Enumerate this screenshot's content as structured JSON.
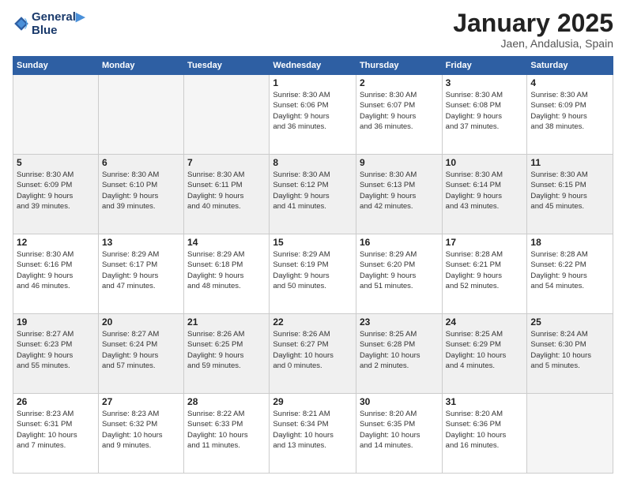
{
  "header": {
    "logo_line1": "General",
    "logo_line2": "Blue",
    "title": "January 2025",
    "subtitle": "Jaen, Andalusia, Spain"
  },
  "days_of_week": [
    "Sunday",
    "Monday",
    "Tuesday",
    "Wednesday",
    "Thursday",
    "Friday",
    "Saturday"
  ],
  "weeks": [
    [
      {
        "day": "",
        "info": ""
      },
      {
        "day": "",
        "info": ""
      },
      {
        "day": "",
        "info": ""
      },
      {
        "day": "1",
        "info": "Sunrise: 8:30 AM\nSunset: 6:06 PM\nDaylight: 9 hours\nand 36 minutes."
      },
      {
        "day": "2",
        "info": "Sunrise: 8:30 AM\nSunset: 6:07 PM\nDaylight: 9 hours\nand 36 minutes."
      },
      {
        "day": "3",
        "info": "Sunrise: 8:30 AM\nSunset: 6:08 PM\nDaylight: 9 hours\nand 37 minutes."
      },
      {
        "day": "4",
        "info": "Sunrise: 8:30 AM\nSunset: 6:09 PM\nDaylight: 9 hours\nand 38 minutes."
      }
    ],
    [
      {
        "day": "5",
        "info": "Sunrise: 8:30 AM\nSunset: 6:09 PM\nDaylight: 9 hours\nand 39 minutes."
      },
      {
        "day": "6",
        "info": "Sunrise: 8:30 AM\nSunset: 6:10 PM\nDaylight: 9 hours\nand 39 minutes."
      },
      {
        "day": "7",
        "info": "Sunrise: 8:30 AM\nSunset: 6:11 PM\nDaylight: 9 hours\nand 40 minutes."
      },
      {
        "day": "8",
        "info": "Sunrise: 8:30 AM\nSunset: 6:12 PM\nDaylight: 9 hours\nand 41 minutes."
      },
      {
        "day": "9",
        "info": "Sunrise: 8:30 AM\nSunset: 6:13 PM\nDaylight: 9 hours\nand 42 minutes."
      },
      {
        "day": "10",
        "info": "Sunrise: 8:30 AM\nSunset: 6:14 PM\nDaylight: 9 hours\nand 43 minutes."
      },
      {
        "day": "11",
        "info": "Sunrise: 8:30 AM\nSunset: 6:15 PM\nDaylight: 9 hours\nand 45 minutes."
      }
    ],
    [
      {
        "day": "12",
        "info": "Sunrise: 8:30 AM\nSunset: 6:16 PM\nDaylight: 9 hours\nand 46 minutes."
      },
      {
        "day": "13",
        "info": "Sunrise: 8:29 AM\nSunset: 6:17 PM\nDaylight: 9 hours\nand 47 minutes."
      },
      {
        "day": "14",
        "info": "Sunrise: 8:29 AM\nSunset: 6:18 PM\nDaylight: 9 hours\nand 48 minutes."
      },
      {
        "day": "15",
        "info": "Sunrise: 8:29 AM\nSunset: 6:19 PM\nDaylight: 9 hours\nand 50 minutes."
      },
      {
        "day": "16",
        "info": "Sunrise: 8:29 AM\nSunset: 6:20 PM\nDaylight: 9 hours\nand 51 minutes."
      },
      {
        "day": "17",
        "info": "Sunrise: 8:28 AM\nSunset: 6:21 PM\nDaylight: 9 hours\nand 52 minutes."
      },
      {
        "day": "18",
        "info": "Sunrise: 8:28 AM\nSunset: 6:22 PM\nDaylight: 9 hours\nand 54 minutes."
      }
    ],
    [
      {
        "day": "19",
        "info": "Sunrise: 8:27 AM\nSunset: 6:23 PM\nDaylight: 9 hours\nand 55 minutes."
      },
      {
        "day": "20",
        "info": "Sunrise: 8:27 AM\nSunset: 6:24 PM\nDaylight: 9 hours\nand 57 minutes."
      },
      {
        "day": "21",
        "info": "Sunrise: 8:26 AM\nSunset: 6:25 PM\nDaylight: 9 hours\nand 59 minutes."
      },
      {
        "day": "22",
        "info": "Sunrise: 8:26 AM\nSunset: 6:27 PM\nDaylight: 10 hours\nand 0 minutes."
      },
      {
        "day": "23",
        "info": "Sunrise: 8:25 AM\nSunset: 6:28 PM\nDaylight: 10 hours\nand 2 minutes."
      },
      {
        "day": "24",
        "info": "Sunrise: 8:25 AM\nSunset: 6:29 PM\nDaylight: 10 hours\nand 4 minutes."
      },
      {
        "day": "25",
        "info": "Sunrise: 8:24 AM\nSunset: 6:30 PM\nDaylight: 10 hours\nand 5 minutes."
      }
    ],
    [
      {
        "day": "26",
        "info": "Sunrise: 8:23 AM\nSunset: 6:31 PM\nDaylight: 10 hours\nand 7 minutes."
      },
      {
        "day": "27",
        "info": "Sunrise: 8:23 AM\nSunset: 6:32 PM\nDaylight: 10 hours\nand 9 minutes."
      },
      {
        "day": "28",
        "info": "Sunrise: 8:22 AM\nSunset: 6:33 PM\nDaylight: 10 hours\nand 11 minutes."
      },
      {
        "day": "29",
        "info": "Sunrise: 8:21 AM\nSunset: 6:34 PM\nDaylight: 10 hours\nand 13 minutes."
      },
      {
        "day": "30",
        "info": "Sunrise: 8:20 AM\nSunset: 6:35 PM\nDaylight: 10 hours\nand 14 minutes."
      },
      {
        "day": "31",
        "info": "Sunrise: 8:20 AM\nSunset: 6:36 PM\nDaylight: 10 hours\nand 16 minutes."
      },
      {
        "day": "",
        "info": ""
      }
    ]
  ]
}
